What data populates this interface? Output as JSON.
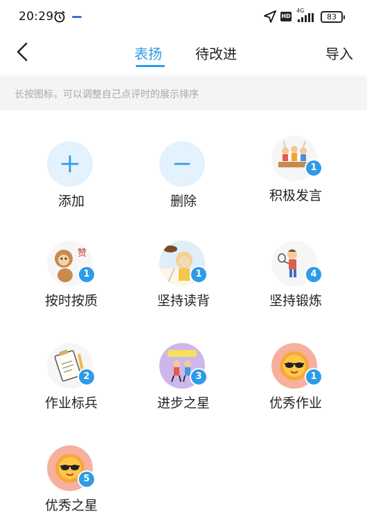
{
  "status_bar": {
    "time": "20:29",
    "hd": "HD",
    "network": "4G",
    "battery": "83"
  },
  "header": {
    "tabs": [
      {
        "label": "表扬",
        "active": true
      },
      {
        "label": "待改进",
        "active": false
      }
    ],
    "import_label": "导入",
    "active_color": "#2e9be8"
  },
  "hint": "长按图标，可以调整自己点评时的展示排序",
  "actions": [
    {
      "label": "添加",
      "icon": "plus-icon"
    },
    {
      "label": "删除",
      "icon": "minus-icon"
    }
  ],
  "items": [
    {
      "label": "积极发言",
      "count": "1",
      "icon": "kids-raising-hands-icon"
    },
    {
      "label": "按时按质",
      "count": "1",
      "icon": "monkey-thumbs-up-icon"
    },
    {
      "label": "坚持读背",
      "count": "1",
      "icon": "girl-reading-icon"
    },
    {
      "label": "坚持锻炼",
      "count": "4",
      "icon": "tennis-player-icon"
    },
    {
      "label": "作业标兵",
      "count": "2",
      "icon": "clipboard-pencil-icon"
    },
    {
      "label": "进步之星",
      "count": "3",
      "icon": "children-dancing-icon"
    },
    {
      "label": "优秀作业",
      "count": "1",
      "icon": "sun-sunglasses-icon"
    },
    {
      "label": "优秀之星",
      "count": "5",
      "icon": "sun-sunglasses-icon"
    }
  ],
  "colors": {
    "accent": "#2e9be8",
    "hint_bg": "#f4f4f4",
    "action_bg": "#e3f2fc"
  }
}
